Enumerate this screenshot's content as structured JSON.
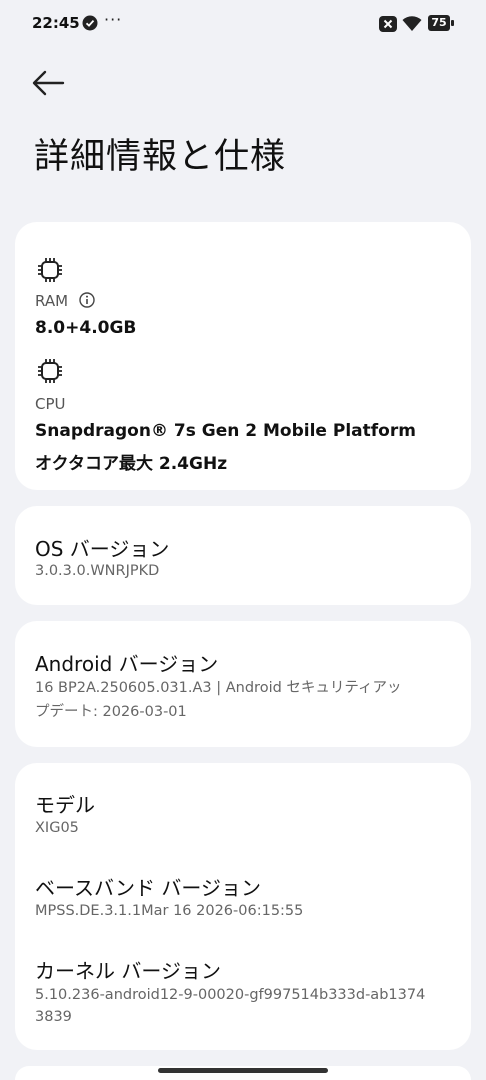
{
  "status_bar": {
    "time": "22:45",
    "dots": "···",
    "battery": "75",
    "icons": [
      "check-circle-icon",
      "close-box-icon",
      "wifi-icon",
      "battery-icon"
    ]
  },
  "header": {
    "back_icon": "arrow-left-icon",
    "title": "詳細情報と仕様"
  },
  "hardware": {
    "ram_label": "RAM",
    "ram_value": "8.0+4.0GB",
    "cpu_label": "CPU",
    "cpu_value_line1": "Snapdragon® 7s Gen 2 Mobile Platform",
    "cpu_value_line2": "オクタコア最大 2.4GHz"
  },
  "os": {
    "label": "OS バージョン",
    "value": "3.0.3.0.WNRJPKD"
  },
  "android": {
    "label": "Android バージョン",
    "value_line1": "16 BP2A.250605.031.A3 | Android セキュリティアッ",
    "value_line2": "プデート: 2026-03-01"
  },
  "device": {
    "model_label": "モデル",
    "model_value": "XIG05",
    "baseband_label": "ベースバンド バージョン",
    "baseband_value": "MPSS.DE.3.1.1Mar 16 2026-06:15:55",
    "kernel_label": "カーネル バージョン",
    "kernel_value_line1": "5.10.236-android12-9-00020-gf997514b333d-ab1374",
    "kernel_value_line2": "3839"
  }
}
